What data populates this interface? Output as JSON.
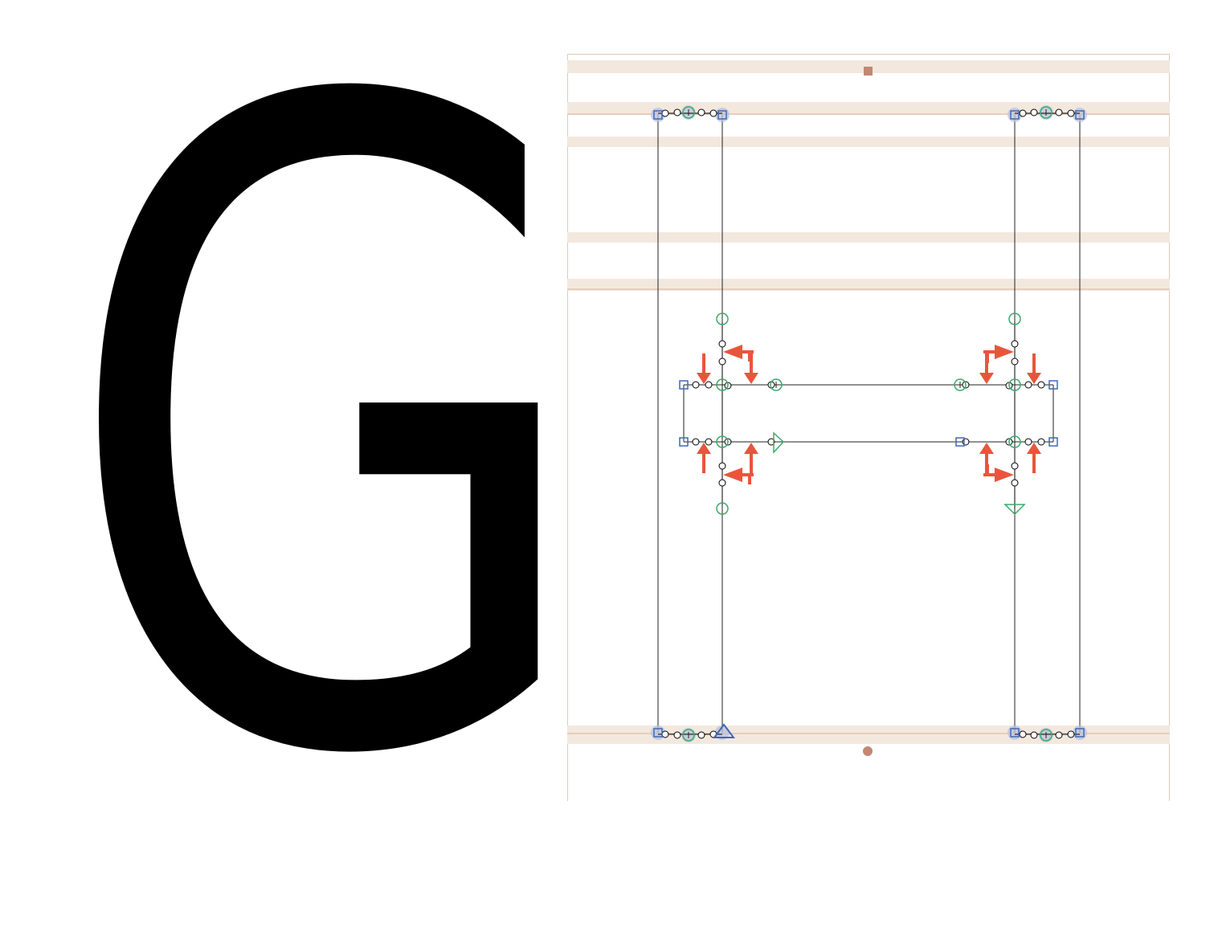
{
  "preview": {
    "glyph": "G"
  },
  "editor": {
    "colors": {
      "zone_band": "#f3e8de",
      "zone_line": "#d9b39a",
      "frame": "#e1c9b6",
      "outline": "#222222",
      "handle": "#000000",
      "curve_point": "#3bab6a",
      "corner_point": "#3f69b4",
      "tangent_point": "#3f69b4",
      "direction_arrow": "#e9553c",
      "anchor_marker": "#c48770",
      "selection_halo": "#b9c2dc"
    },
    "icons": {
      "curve_point": "circle-plus-icon",
      "corner_point": "square-icon",
      "start_point": "triangle-icon",
      "direction": "red-arrow-icon",
      "metric_anchor": "square-marker-icon",
      "origin_anchor": "dot-marker-icon"
    }
  }
}
